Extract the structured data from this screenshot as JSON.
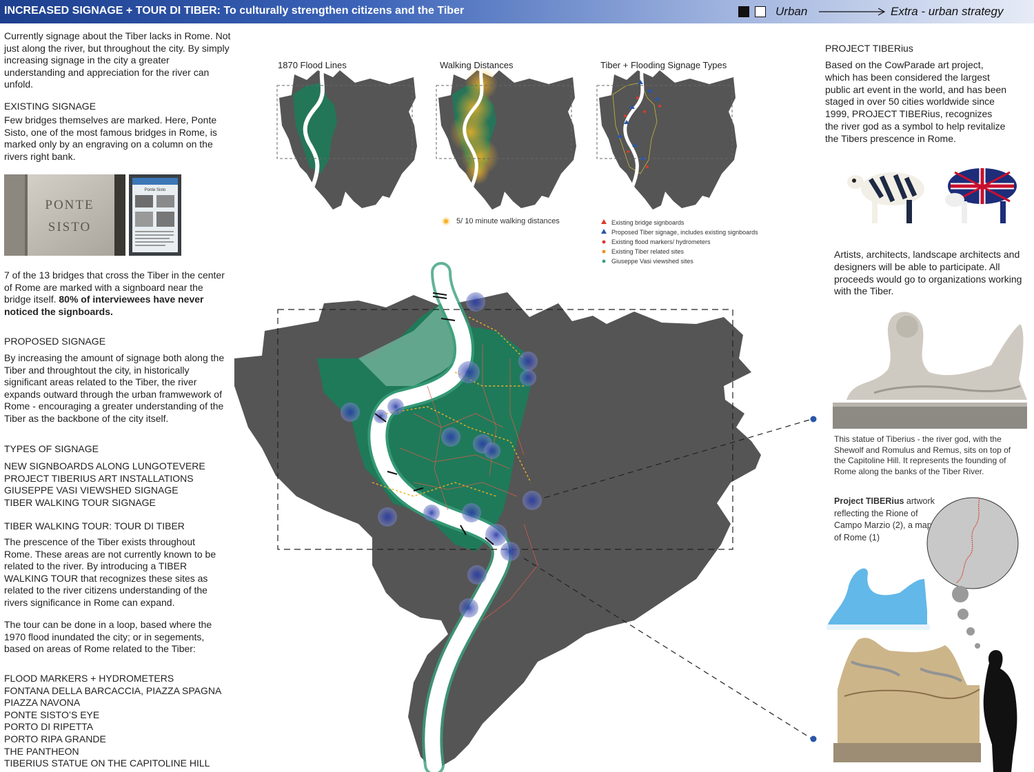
{
  "header": {
    "title": "INCREASED SIGNAGE + TOUR DI TIBER: To culturally strengthen citizens and the Tiber",
    "legend_urban": "Urban",
    "legend_extra": "Extra - urban strategy",
    "gradient_start": "#1d3f8e",
    "gradient_end": "#e6ebf6"
  },
  "left": {
    "intro": "Currently signage about the Tiber lacks in Rome. Not just along the river, but throughout the city. By simply increasing signage in the city a greater understanding and appreciation for the river can unfold.",
    "existing_heading": "EXISTING SIGNAGE",
    "existing_text": "Few bridges themselves are marked. Here, Ponte Sisto, one of the most famous bridges in Rome, is marked only by an engraving on a column on the rivers right bank.",
    "engraving_line1": "PONTE",
    "engraving_line2": "SISTO",
    "signboard_title": "Ponte Sisto",
    "bridges_text": "7 of the 13 bridges that cross the Tiber in the center of Rome are marked with a signboard near the bridge itself.",
    "bridges_bold": "80% of interviewees have never noticed the signboards.",
    "proposed_heading": "PROPOSED SIGNAGE",
    "proposed_text": "By increasing the amount of signage both along the Tiber and throughtout the city, in historically significant areas related to the Tiber, the river expands outward through the urban framwework of Rome - encouraging a greater understanding of the Tiber as the backbone of the city itself.",
    "types_heading": "TYPES OF SIGNAGE",
    "types": [
      "NEW SIGNBOARDS ALONG LUNGOTEVERE",
      "PROJECT TIBERIUS ART INSTALLATIONS",
      "GIUSEPPE VASI VIEWSHED SIGNAGE",
      "TIBER WALKING TOUR SIGNAGE"
    ],
    "tour_heading": "TIBER WALKING TOUR: TOUR DI TIBER",
    "tour_text": "The prescence of the Tiber exists throughout Rome. These areas are not currently known to be related to the river. By introducing a TIBER WALKING TOUR that recognizes these sites as related to the river citizens understanding of the rivers significance in Rome can expand.",
    "loop_text": "The tour can be done in a loop, based where the 1970 flood inundated the city; or in segements, based on areas of Rome related to the Tiber:",
    "sites": [
      "FLOOD MARKERS + HYDROMETERS",
      "FONTANA DELLA BARCACCIA, PIAZZA SPAGNA",
      "PIAZZA NAVONA",
      "PONTE SISTO’S EYE",
      "PORTO DI RIPETTA",
      "PORTO RIPA GRANDE",
      "THE PANTHEON",
      "TIBERIUS STATUE ON THE CAPITOLINE HILL"
    ]
  },
  "maps": {
    "titles": [
      "1870 Flood Lines",
      "Walking Distances",
      "Tiber + Flooding Signage Types"
    ],
    "walking_legend": "5/ 10 minute walking distances",
    "signage_legend": [
      {
        "label": "Existing bridge signboards",
        "color": "#d93a2b",
        "shape": "triangle"
      },
      {
        "label": "Proposed Tiber signage, includes existing signboards",
        "color": "#2a56a8",
        "shape": "triangle"
      },
      {
        "label": "Existing flood markers/ hydrometers",
        "color": "#e03131",
        "shape": "dot"
      },
      {
        "label": "Existing Tiber related sites",
        "color": "#f08c1a",
        "shape": "dot"
      },
      {
        "label": "Giuseppe Vasi viewshed sites",
        "color": "#3aa07a",
        "shape": "dot"
      }
    ],
    "colors": {
      "city": "#555555",
      "flood": "#1f7a5a",
      "river": "#ffffff",
      "nodes": "#2b3ea6"
    }
  },
  "right": {
    "project_heading": "PROJECT TIBERius",
    "project_text": "Based on the CowParade art project, which has been considered the largest public art event in the world, and  has been staged in over 50 cities worldwide since 1999, PROJECT TIBERius, recognizes the river god as a symbol to help revitalize the Tibers prescence in Rome.",
    "participate_text": "Artists, architects, landscape architects and designers will be able to participate. All proceeds would go to organizations working with the Tiber.",
    "statue_caption": "This statue of  Tiberius - the river god, with the Shewolf and Romulus and Remus, sits on top of the Capitoline Hill.  It represents the founding of Rome along the banks of the Tiber River.",
    "artwork_bold": "Project TIBERius",
    "artwork_text": " artwork reflecting the Rione of Campo Marzio (2), a map of Rome (1)"
  }
}
